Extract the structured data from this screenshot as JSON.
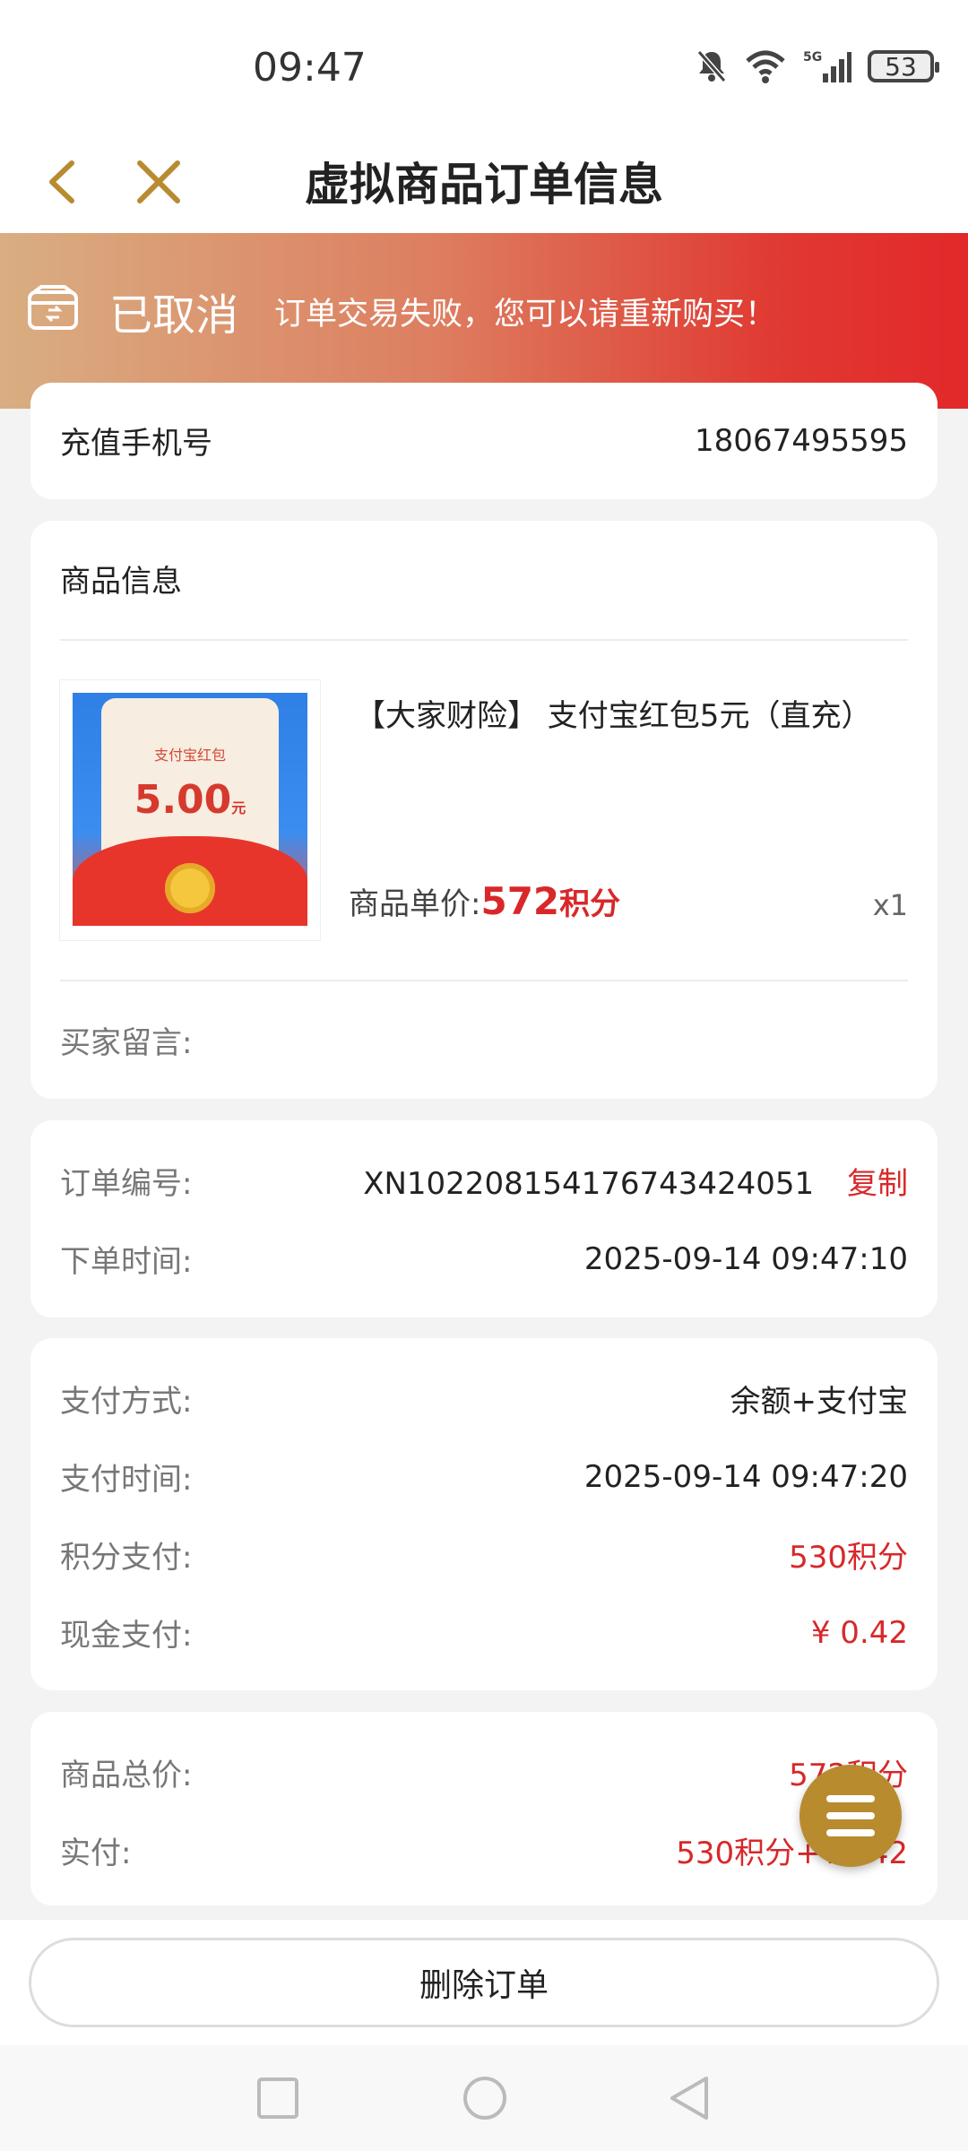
{
  "status_bar": {
    "time": "09:47",
    "battery": "53",
    "network": "5G"
  },
  "nav": {
    "title": "虚拟商品订单信息"
  },
  "banner": {
    "status": "已取消",
    "message": "订单交易失败，您可以请重新购买！"
  },
  "recharge": {
    "label": "充值手机号",
    "value": "18067495595"
  },
  "product": {
    "section_title": "商品信息",
    "image": {
      "label": "支付宝红包",
      "value": "5.00",
      "unit": "元"
    },
    "name": "【大家财险】 支付宝红包5元（直充）",
    "price_label": "商品单价:",
    "price_value": "572",
    "price_unit": "积分",
    "quantity": "x1",
    "message_label": "买家留言:"
  },
  "order": {
    "number_label": "订单编号:",
    "number_value": "XN1022081541767434240​51",
    "copy": "复制",
    "time_label": "下单时间:",
    "time_value": "2025-09-14 09:47:10"
  },
  "payment": {
    "method_label": "支付方式:",
    "method_value": "余额+支付宝",
    "time_label": "支付时间:",
    "time_value": "2025-09-14 09:47:20",
    "points_label": "积分支付:",
    "points_value": "530积分",
    "cash_label": "现金支付:",
    "cash_value": "¥ 0.42"
  },
  "totals": {
    "total_label": "商品总价:",
    "total_value": "572积分",
    "paid_label": "实付:",
    "paid_points": "530积分",
    "paid_cash": "+¥0.42"
  },
  "actions": {
    "delete": "删除订单"
  },
  "colors": {
    "accent": "#d8282a",
    "gold": "#b88b2f",
    "banner_start": "#d9ae82",
    "banner_end": "#e3282a"
  }
}
